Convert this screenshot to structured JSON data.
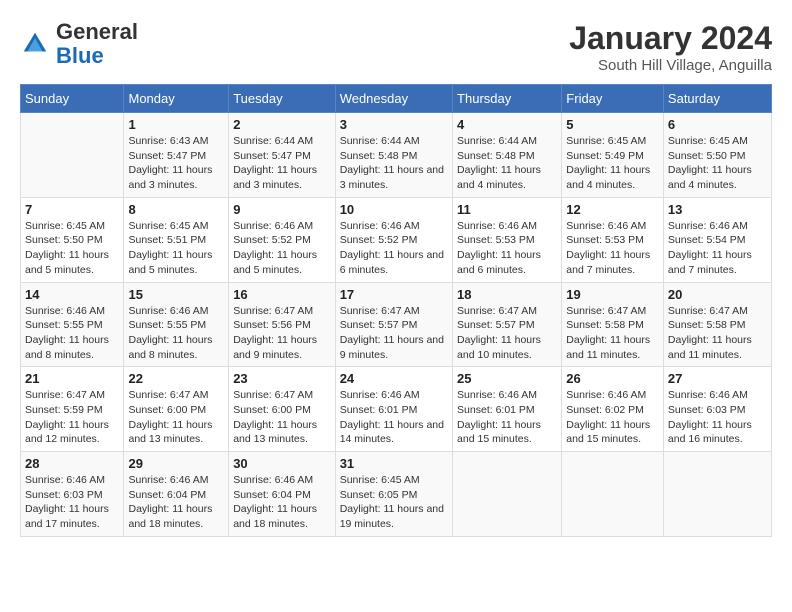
{
  "header": {
    "logo_general": "General",
    "logo_blue": "Blue",
    "month_year": "January 2024",
    "location": "South Hill Village, Anguilla"
  },
  "columns": [
    "Sunday",
    "Monday",
    "Tuesday",
    "Wednesday",
    "Thursday",
    "Friday",
    "Saturday"
  ],
  "weeks": [
    [
      {
        "day": "",
        "sunrise": "",
        "sunset": "",
        "daylight": ""
      },
      {
        "day": "1",
        "sunrise": "Sunrise: 6:43 AM",
        "sunset": "Sunset: 5:47 PM",
        "daylight": "Daylight: 11 hours and 3 minutes."
      },
      {
        "day": "2",
        "sunrise": "Sunrise: 6:44 AM",
        "sunset": "Sunset: 5:47 PM",
        "daylight": "Daylight: 11 hours and 3 minutes."
      },
      {
        "day": "3",
        "sunrise": "Sunrise: 6:44 AM",
        "sunset": "Sunset: 5:48 PM",
        "daylight": "Daylight: 11 hours and 3 minutes."
      },
      {
        "day": "4",
        "sunrise": "Sunrise: 6:44 AM",
        "sunset": "Sunset: 5:48 PM",
        "daylight": "Daylight: 11 hours and 4 minutes."
      },
      {
        "day": "5",
        "sunrise": "Sunrise: 6:45 AM",
        "sunset": "Sunset: 5:49 PM",
        "daylight": "Daylight: 11 hours and 4 minutes."
      },
      {
        "day": "6",
        "sunrise": "Sunrise: 6:45 AM",
        "sunset": "Sunset: 5:50 PM",
        "daylight": "Daylight: 11 hours and 4 minutes."
      }
    ],
    [
      {
        "day": "7",
        "sunrise": "Sunrise: 6:45 AM",
        "sunset": "Sunset: 5:50 PM",
        "daylight": "Daylight: 11 hours and 5 minutes."
      },
      {
        "day": "8",
        "sunrise": "Sunrise: 6:45 AM",
        "sunset": "Sunset: 5:51 PM",
        "daylight": "Daylight: 11 hours and 5 minutes."
      },
      {
        "day": "9",
        "sunrise": "Sunrise: 6:46 AM",
        "sunset": "Sunset: 5:52 PM",
        "daylight": "Daylight: 11 hours and 5 minutes."
      },
      {
        "day": "10",
        "sunrise": "Sunrise: 6:46 AM",
        "sunset": "Sunset: 5:52 PM",
        "daylight": "Daylight: 11 hours and 6 minutes."
      },
      {
        "day": "11",
        "sunrise": "Sunrise: 6:46 AM",
        "sunset": "Sunset: 5:53 PM",
        "daylight": "Daylight: 11 hours and 6 minutes."
      },
      {
        "day": "12",
        "sunrise": "Sunrise: 6:46 AM",
        "sunset": "Sunset: 5:53 PM",
        "daylight": "Daylight: 11 hours and 7 minutes."
      },
      {
        "day": "13",
        "sunrise": "Sunrise: 6:46 AM",
        "sunset": "Sunset: 5:54 PM",
        "daylight": "Daylight: 11 hours and 7 minutes."
      }
    ],
    [
      {
        "day": "14",
        "sunrise": "Sunrise: 6:46 AM",
        "sunset": "Sunset: 5:55 PM",
        "daylight": "Daylight: 11 hours and 8 minutes."
      },
      {
        "day": "15",
        "sunrise": "Sunrise: 6:46 AM",
        "sunset": "Sunset: 5:55 PM",
        "daylight": "Daylight: 11 hours and 8 minutes."
      },
      {
        "day": "16",
        "sunrise": "Sunrise: 6:47 AM",
        "sunset": "Sunset: 5:56 PM",
        "daylight": "Daylight: 11 hours and 9 minutes."
      },
      {
        "day": "17",
        "sunrise": "Sunrise: 6:47 AM",
        "sunset": "Sunset: 5:57 PM",
        "daylight": "Daylight: 11 hours and 9 minutes."
      },
      {
        "day": "18",
        "sunrise": "Sunrise: 6:47 AM",
        "sunset": "Sunset: 5:57 PM",
        "daylight": "Daylight: 11 hours and 10 minutes."
      },
      {
        "day": "19",
        "sunrise": "Sunrise: 6:47 AM",
        "sunset": "Sunset: 5:58 PM",
        "daylight": "Daylight: 11 hours and 11 minutes."
      },
      {
        "day": "20",
        "sunrise": "Sunrise: 6:47 AM",
        "sunset": "Sunset: 5:58 PM",
        "daylight": "Daylight: 11 hours and 11 minutes."
      }
    ],
    [
      {
        "day": "21",
        "sunrise": "Sunrise: 6:47 AM",
        "sunset": "Sunset: 5:59 PM",
        "daylight": "Daylight: 11 hours and 12 minutes."
      },
      {
        "day": "22",
        "sunrise": "Sunrise: 6:47 AM",
        "sunset": "Sunset: 6:00 PM",
        "daylight": "Daylight: 11 hours and 13 minutes."
      },
      {
        "day": "23",
        "sunrise": "Sunrise: 6:47 AM",
        "sunset": "Sunset: 6:00 PM",
        "daylight": "Daylight: 11 hours and 13 minutes."
      },
      {
        "day": "24",
        "sunrise": "Sunrise: 6:46 AM",
        "sunset": "Sunset: 6:01 PM",
        "daylight": "Daylight: 11 hours and 14 minutes."
      },
      {
        "day": "25",
        "sunrise": "Sunrise: 6:46 AM",
        "sunset": "Sunset: 6:01 PM",
        "daylight": "Daylight: 11 hours and 15 minutes."
      },
      {
        "day": "26",
        "sunrise": "Sunrise: 6:46 AM",
        "sunset": "Sunset: 6:02 PM",
        "daylight": "Daylight: 11 hours and 15 minutes."
      },
      {
        "day": "27",
        "sunrise": "Sunrise: 6:46 AM",
        "sunset": "Sunset: 6:03 PM",
        "daylight": "Daylight: 11 hours and 16 minutes."
      }
    ],
    [
      {
        "day": "28",
        "sunrise": "Sunrise: 6:46 AM",
        "sunset": "Sunset: 6:03 PM",
        "daylight": "Daylight: 11 hours and 17 minutes."
      },
      {
        "day": "29",
        "sunrise": "Sunrise: 6:46 AM",
        "sunset": "Sunset: 6:04 PM",
        "daylight": "Daylight: 11 hours and 18 minutes."
      },
      {
        "day": "30",
        "sunrise": "Sunrise: 6:46 AM",
        "sunset": "Sunset: 6:04 PM",
        "daylight": "Daylight: 11 hours and 18 minutes."
      },
      {
        "day": "31",
        "sunrise": "Sunrise: 6:45 AM",
        "sunset": "Sunset: 6:05 PM",
        "daylight": "Daylight: 11 hours and 19 minutes."
      },
      {
        "day": "",
        "sunrise": "",
        "sunset": "",
        "daylight": ""
      },
      {
        "day": "",
        "sunrise": "",
        "sunset": "",
        "daylight": ""
      },
      {
        "day": "",
        "sunrise": "",
        "sunset": "",
        "daylight": ""
      }
    ]
  ]
}
